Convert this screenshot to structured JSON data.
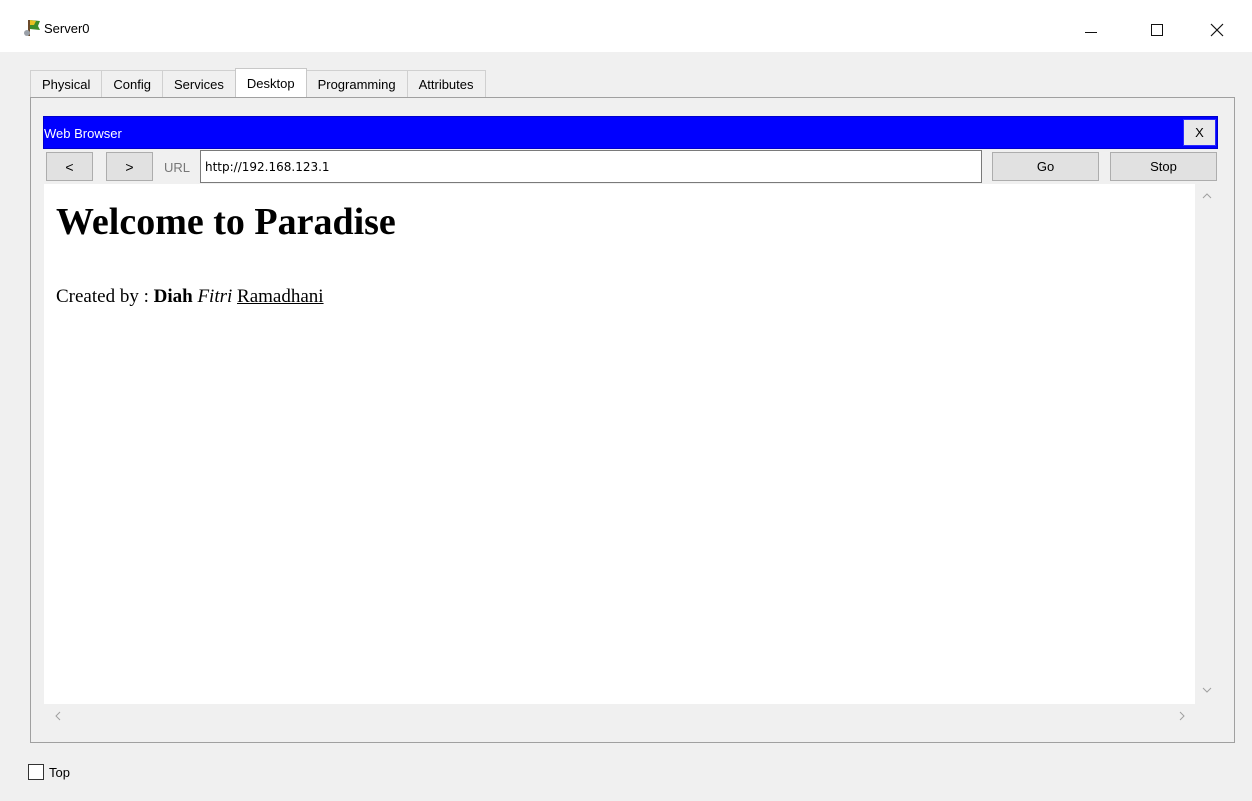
{
  "window": {
    "title": "Server0",
    "controls": {
      "minimize": "—",
      "maximize": "☐",
      "close": "✕"
    }
  },
  "tabs": [
    {
      "label": "Physical",
      "active": false
    },
    {
      "label": "Config",
      "active": false
    },
    {
      "label": "Services",
      "active": false
    },
    {
      "label": "Desktop",
      "active": true
    },
    {
      "label": "Programming",
      "active": false
    },
    {
      "label": "Attributes",
      "active": false
    }
  ],
  "browser": {
    "title": "Web Browser",
    "close_label": "X",
    "back_label": "<",
    "forward_label": ">",
    "url_label": "URL",
    "url_value": "http://192.168.123.1",
    "go_label": "Go",
    "stop_label": "Stop",
    "title_bar_color": "#0000ff"
  },
  "page": {
    "heading": "Welcome to Paradise",
    "credit_prefix": "Created by : ",
    "credit_bold": "Diah",
    "credit_italic": "Fitri",
    "credit_underline": "Ramadhani"
  },
  "footer": {
    "top_label": "Top",
    "top_checked": false
  },
  "icons": {
    "app": "server-icon",
    "scroll_up": "chevron-up-icon",
    "scroll_down": "chevron-down-icon",
    "scroll_left": "chevron-left-icon",
    "scroll_right": "chevron-right-icon"
  }
}
